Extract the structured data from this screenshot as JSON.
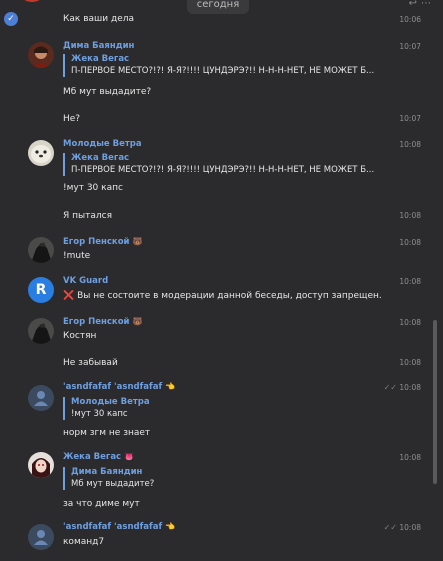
{
  "date_chip": "сегодня",
  "top_icons": [
    "reply-icon",
    "more-icon"
  ],
  "messages": [
    {
      "text": "Как ваши дела",
      "time": "10:06"
    },
    {
      "author": "Дима Баяндин",
      "time": "10:07",
      "quote_name": "Жека Вегас",
      "quote_text": "П-ПЕРВОЕ МЕСТО?!?! Я-Я?!!!! ЦУНДЭРЭ?!! Н-Н-Н-НЕТ, НЕ МОЖЕТ Б...",
      "text": "Мб мут выдадите?"
    },
    {
      "text": "Не?",
      "time": "10:07"
    },
    {
      "author": "Молодые Ветра",
      "time": "10:08",
      "quote_name": "Жека Вегас",
      "quote_text": "П-ПЕРВОЕ МЕСТО?!?! Я-Я?!!!! ЦУНДЭРЭ?!! Н-Н-Н-НЕТ, НЕ МОЖЕТ Б...",
      "text": "!мут 30 капс"
    },
    {
      "text": "Я пытался",
      "time": "10:08"
    },
    {
      "author": "Егор Пенской",
      "author_emoji": "🐻",
      "time": "10:08",
      "text": "!mute"
    },
    {
      "author": "VK Guard",
      "time": "10:08",
      "text": "❌ Вы не состоите в модерации данной беседы, доступ запрещен."
    },
    {
      "author": "Егор Пенской",
      "author_emoji": "🐻",
      "time": "10:08",
      "text": "Костян"
    },
    {
      "text": "Не забывай",
      "time": "10:08"
    },
    {
      "author": "'asndfafaf 'asndfafaf",
      "author_emoji": "👈",
      "time": "10:08",
      "quote_name": "Молодые Ветра",
      "quote_text": "!мут 30 капс",
      "text": "норм згм не знает"
    },
    {
      "author": "Жека Вегас",
      "author_emoji": "👅",
      "time": "10:08",
      "quote_name": "Дима Баяндин",
      "quote_text": "Мб мут выдадите?",
      "text": "за что диме мут"
    },
    {
      "author": "'asndfafaf 'asndfafaf",
      "author_emoji": "👈",
      "time": "10:08",
      "text": "команд7"
    }
  ],
  "colors": {
    "background": "#2b2b2d",
    "author": "#6e9fe0",
    "text": "#e6e6e6",
    "time": "#8e8e8e"
  }
}
